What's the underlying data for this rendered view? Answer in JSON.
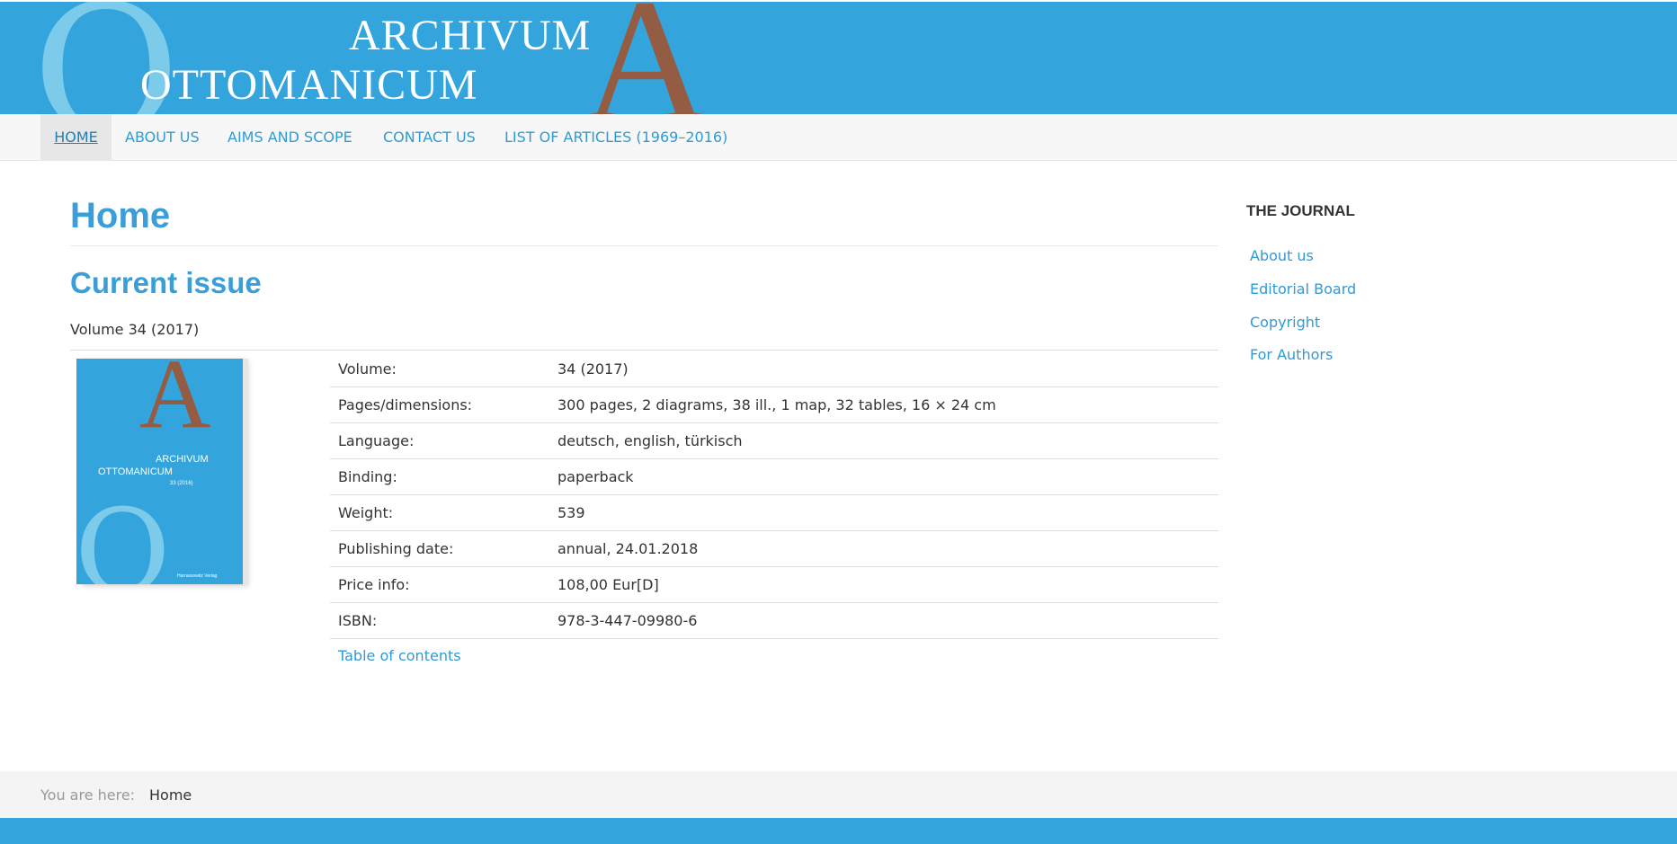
{
  "header": {
    "logo_line1": "ARCHIVUM",
    "logo_line2": "OTTOMANICUM",
    "logo_letter_o": "O",
    "logo_letter_a": "A"
  },
  "nav": {
    "items": [
      {
        "label": "HOME",
        "active": true
      },
      {
        "label": "ABOUT US"
      },
      {
        "label": "AIMS AND SCOPE"
      },
      {
        "label": "CONTACT US"
      },
      {
        "label": "LIST OF ARTICLES (1969–2016)"
      }
    ]
  },
  "main": {
    "page_title": "Home",
    "issue_heading": "Current issue",
    "volume_line": "Volume 34 (2017)",
    "cover": {
      "letter_a": "A",
      "title_line1": "ARCHIVUM",
      "title_line2": "OTTOMANICUM",
      "issue": "33 (2016)",
      "letter_o": "O",
      "publisher": "Harrassowitz Verlag"
    },
    "details": [
      {
        "label": "Volume:",
        "value": "34 (2017)"
      },
      {
        "label": "Pages/dimensions:",
        "value": "300 pages, 2 diagrams, 38 ill., 1 map, 32 tables, 16 × 24 cm"
      },
      {
        "label": "Language:",
        "value": "deutsch, english, türkisch"
      },
      {
        "label": "Binding:",
        "value": "paperback"
      },
      {
        "label": "Weight:",
        "value": "539"
      },
      {
        "label": "Publishing date:",
        "value": "annual, 24.01.2018"
      },
      {
        "label": "Price info:",
        "value": "108,00 Eur[D]"
      },
      {
        "label": "ISBN:",
        "value": "978-3-447-09980-6"
      }
    ],
    "toc_link": "Table of contents"
  },
  "sidebar": {
    "heading": "THE JOURNAL",
    "links": [
      "About us",
      "Editorial Board",
      "Copyright",
      "For Authors"
    ]
  },
  "breadcrumb": {
    "prefix": "You are here:",
    "current": "Home"
  },
  "colors": {
    "brand_blue": "#33a4dc",
    "brand_brown": "#945c42",
    "light_blue": "#7ccbea",
    "link_blue": "#2f9bd5"
  }
}
